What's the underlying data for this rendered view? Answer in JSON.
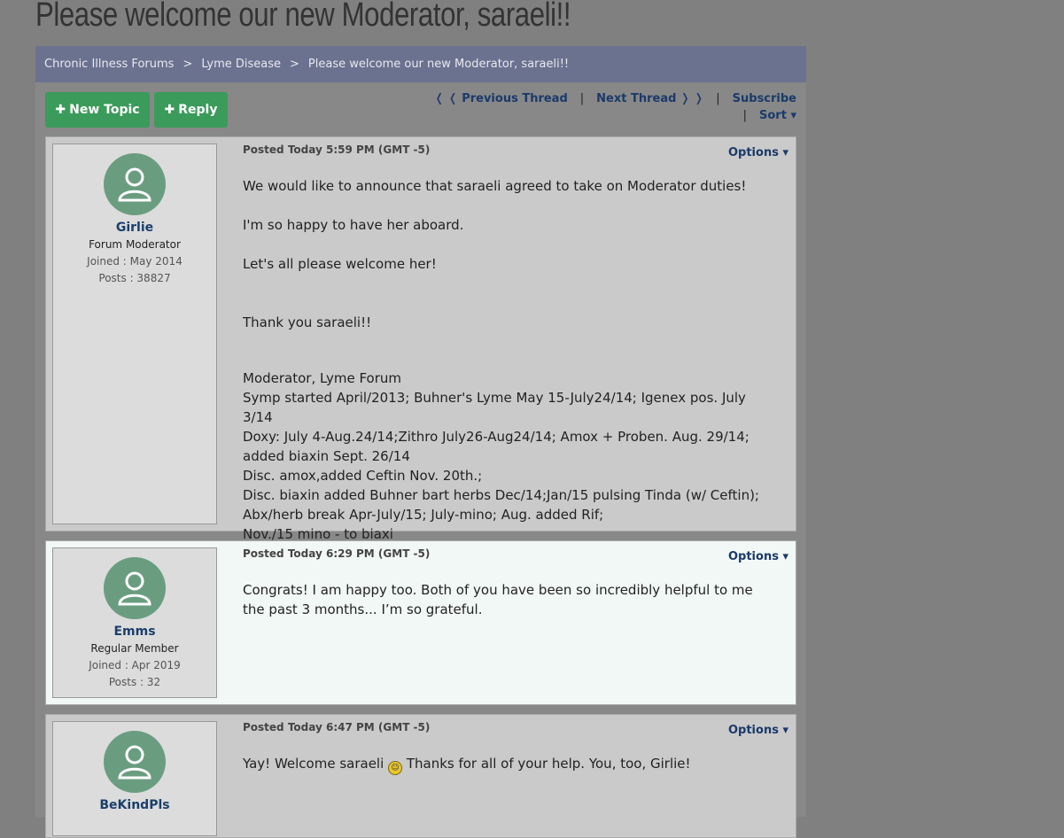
{
  "page": {
    "title": "Please welcome our new Moderator, saraeli!!"
  },
  "breadcrumb": {
    "items": [
      "Chronic Illness Forums",
      "Lyme Disease",
      "Please welcome our new Moderator, saraeli!!"
    ],
    "separator": ">"
  },
  "toolbar": {
    "new_topic_label": "New Topic",
    "reply_label": "Reply",
    "prev_thread_label": "❬ ❬ Previous Thread",
    "next_thread_label": "Next Thread ❭ ❭",
    "subscribe_label": "Subscribe",
    "sort_label": "Sort ▾",
    "separator": "|"
  },
  "posts": [
    {
      "username": "Girlie",
      "role": "Forum Moderator",
      "joined": "Joined : May 2014",
      "posts": "Posts : 38827",
      "posted": "Posted Today 5:59 PM (GMT -5)",
      "options_label": "Options ▾",
      "paragraphs": [
        "We would like to announce that saraeli agreed to take on Moderator duties!",
        "I'm so happy to have her aboard.",
        "Let's all please welcome her!",
        "Thank you saraeli!!"
      ],
      "signature": [
        "Moderator, Lyme Forum",
        "Symp started April/2013; Buhner's Lyme May 15-July24/14; Igenex pos. July 3/14",
        "Doxy: July 4-Aug.24/14;Zithro July26-Aug24/14; Amox + Proben. Aug. 29/14;",
        "added biaxin Sept. 26/14",
        "Disc. amox,added Ceftin Nov. 20th.;",
        "Disc. biaxin added Buhner bart herbs Dec/14;Jan/15 pulsing Tinda (w/ Ceftin);",
        "Abx/herb break Apr-July/15; July-mino; Aug. added Rif;",
        "Nov./15 mino - to biaxi"
      ]
    },
    {
      "username": "Emms",
      "role": "Regular Member",
      "joined": "Joined : Apr 2019",
      "posts": "Posts : 32",
      "posted": "Posted Today 6:29 PM (GMT -5)",
      "options_label": "Options ▾",
      "paragraphs": [
        "Congrats! I am happy too. Both of you have been so incredibly helpful to me the past 3 months... I’m so grateful."
      ]
    },
    {
      "username": "BeKindPls",
      "posted": "Posted Today 6:47 PM (GMT -5)",
      "options_label": "Options ▾",
      "text_before": "Yay! Welcome saraeli",
      "text_after": "Thanks for all of your help. You, too, Girlie!"
    }
  ],
  "colors": {
    "background": "#808080",
    "breadcrumb_bar": "#6b7290",
    "button": "#3a9b5a",
    "link": "#1a3f6b",
    "avatar": "#6a9d80"
  }
}
